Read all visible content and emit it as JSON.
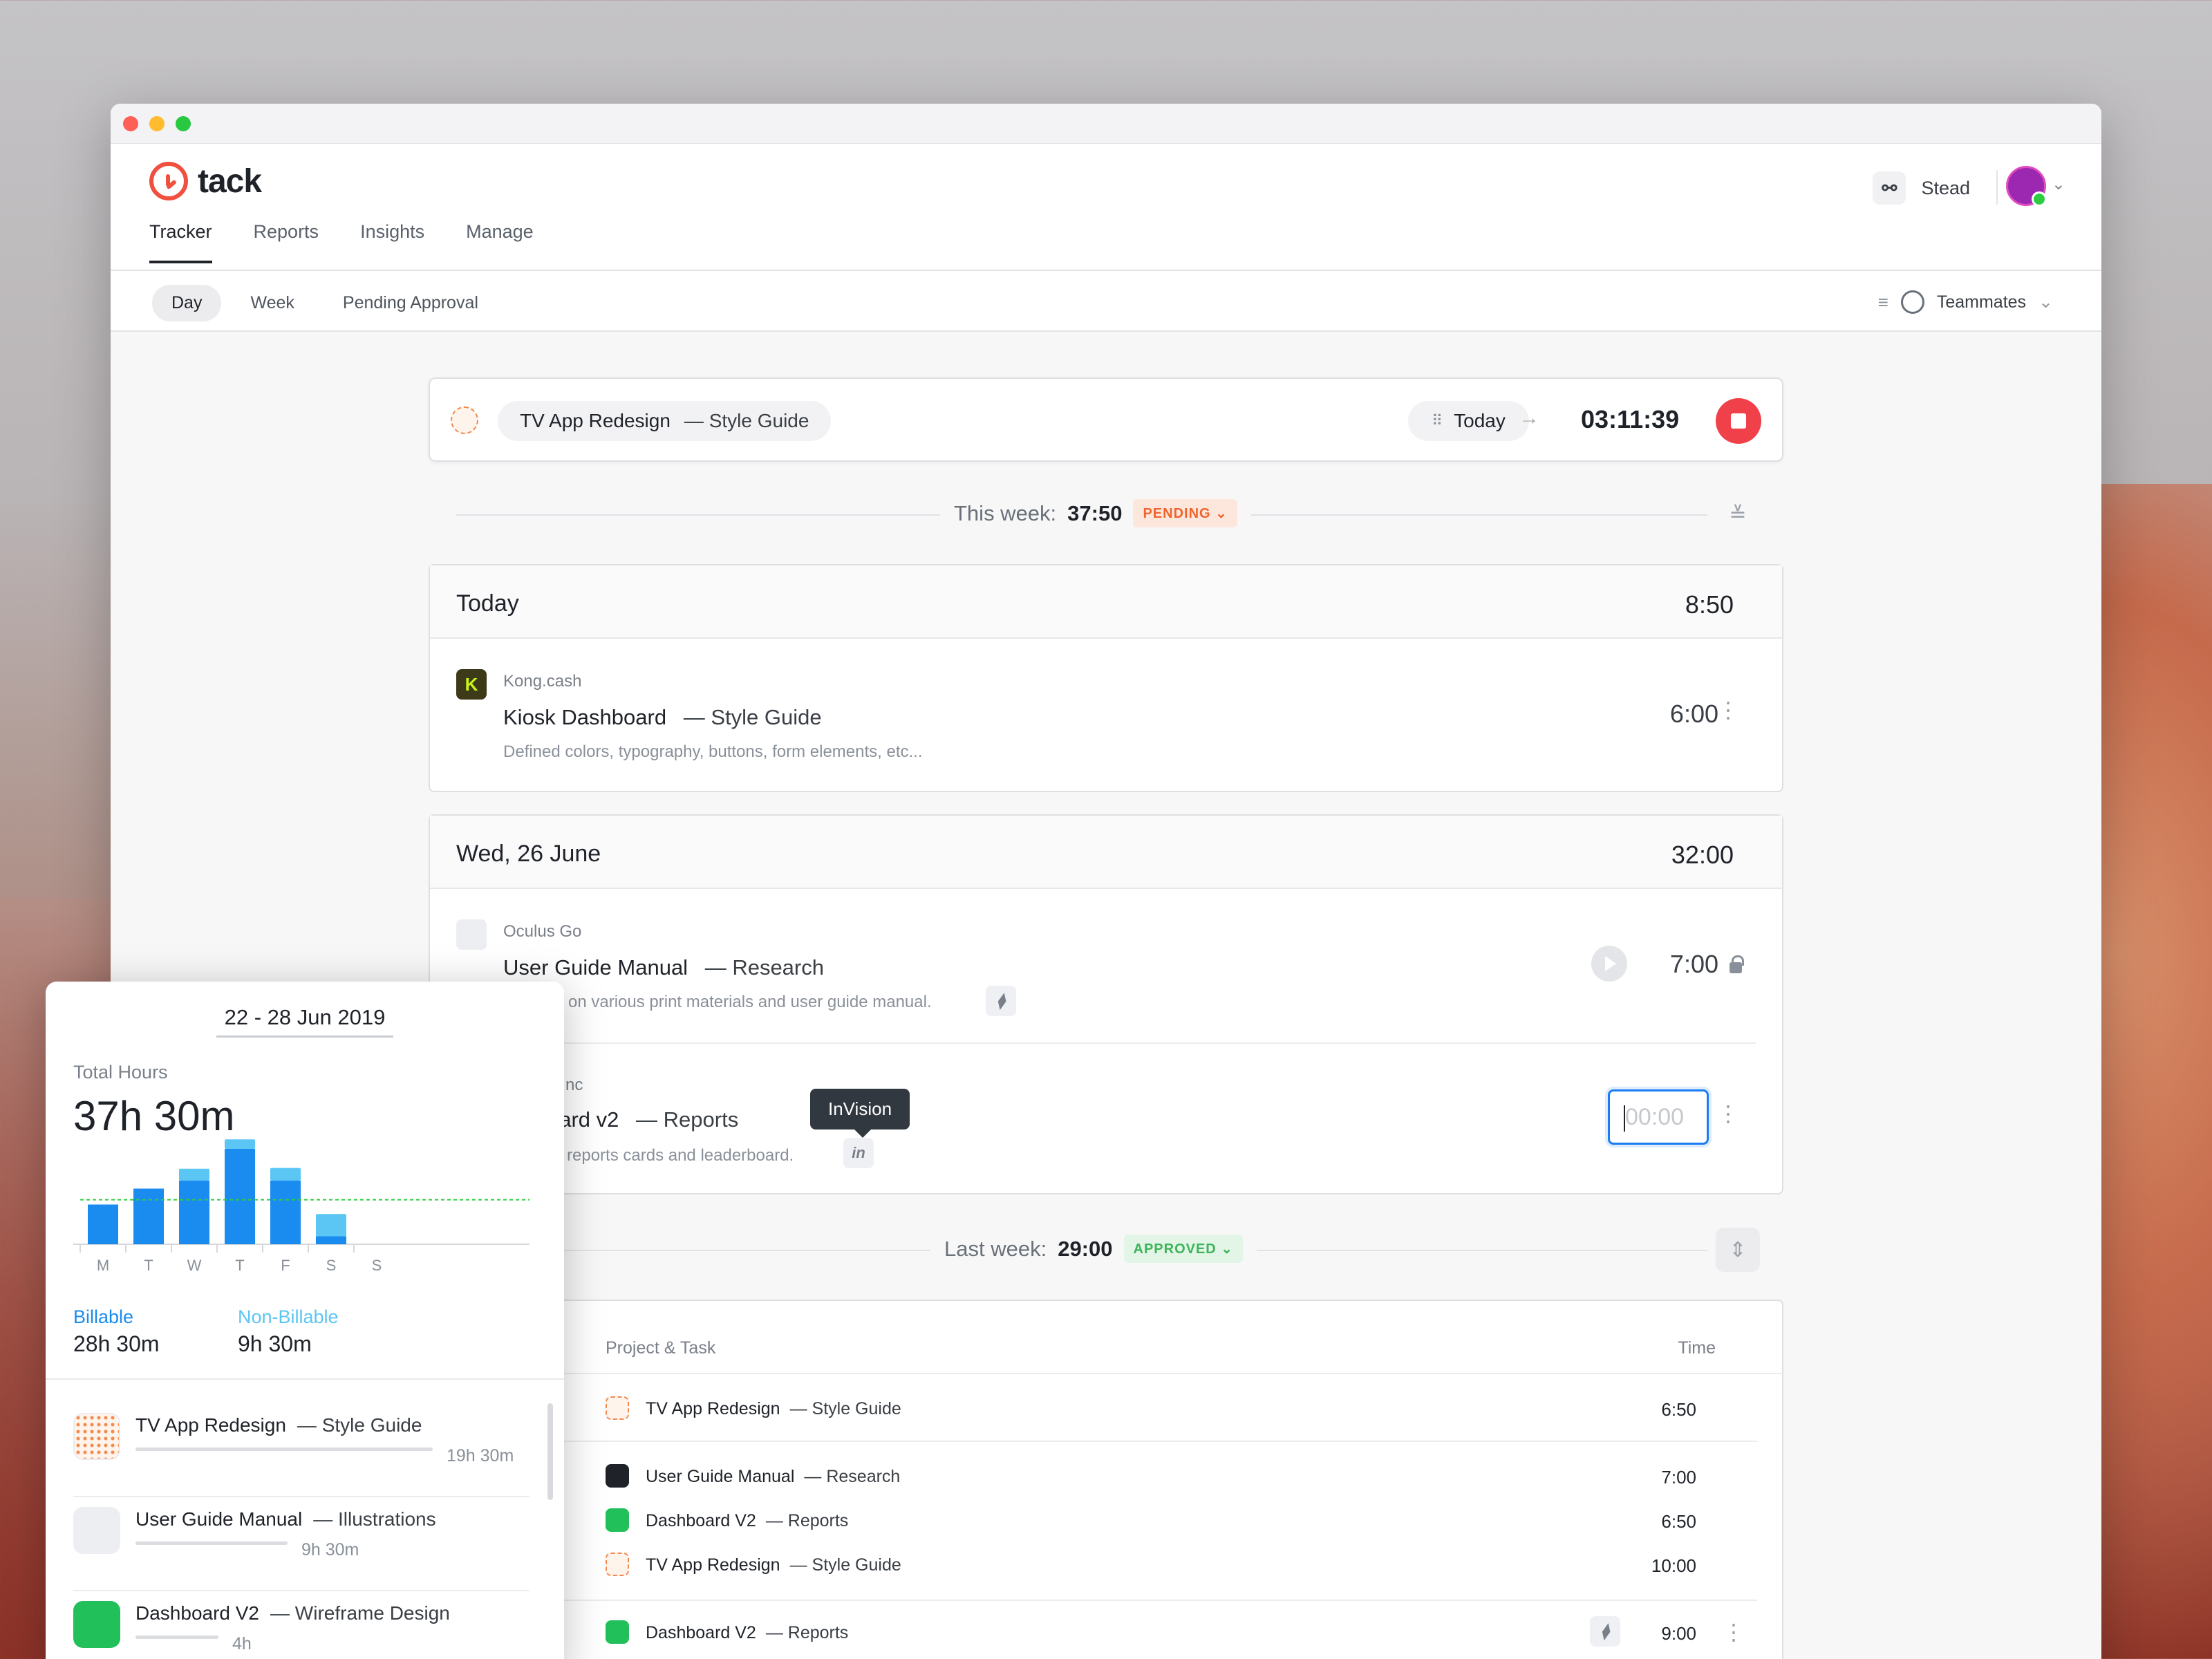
{
  "app": {
    "name": "tack"
  },
  "header": {
    "nav": [
      "Tracker",
      "Reports",
      "Insights",
      "Manage"
    ],
    "workspace": "Stead"
  },
  "subnav": {
    "tabs": [
      "Day",
      "Week",
      "Pending Approval"
    ],
    "filter_label": "Teammates"
  },
  "timer": {
    "project": "TV App Redesign",
    "task": "— Style Guide",
    "day": "Today",
    "elapsed": "03:11:39"
  },
  "this_week": {
    "label": "This week:",
    "total": "37:50",
    "status": "PENDING"
  },
  "today_card": {
    "date": "Today",
    "total": "8:50",
    "entries": [
      {
        "client": "Kong.cash",
        "project": "Kiosk Dashboard",
        "task": "— Style Guide",
        "desc": "Defined colors, typography, buttons, form elements, etc...",
        "time": "6:00",
        "icon_letter": "K"
      }
    ]
  },
  "wed_card": {
    "date": "Wed, 26 June",
    "total": "32:00",
    "entries": [
      {
        "client": "Oculus Go",
        "project": "User Guide Manual",
        "task": "— Research",
        "desc": "on various print materials and user guide manual.",
        "time": "7:00"
      },
      {
        "client": "nc",
        "project": "oard v2",
        "task": "— Reports",
        "desc": "d reports cards and leaderboard.",
        "time_placeholder": "00:00",
        "tooltip": "InVision"
      }
    ]
  },
  "last_week": {
    "label": "Last week:",
    "total": "29:00",
    "status": "APPROVED",
    "columns": {
      "project": "Project & Task",
      "time": "Time"
    },
    "rows": [
      {
        "project": "TV App Redesign",
        "task": "— Style Guide",
        "time": "6:50"
      },
      {
        "project": "User Guide Manual",
        "task": "— Research",
        "time": "7:00"
      },
      {
        "project": "Dashboard V2",
        "task": "— Reports",
        "time": "6:50"
      },
      {
        "project": "TV App Redesign",
        "task": "— Style Guide",
        "time": "10:00"
      },
      {
        "project": "Dashboard V2",
        "task": "— Reports",
        "time": "9:00"
      }
    ]
  },
  "popup": {
    "range": "22 - 28 Jun 2019",
    "total_label": "Total Hours",
    "total_value": "37h 30m",
    "billable_label": "Billable",
    "billable_value": "28h 30m",
    "nonbillable_label": "Non-Billable",
    "nonbillable_value": "9h 30m",
    "projects": [
      {
        "project": "TV App Redesign",
        "task": "— Style Guide",
        "hours": "19h 30m"
      },
      {
        "project": "User Guide Manual",
        "task": "— Illustrations",
        "hours": "9h 30m"
      },
      {
        "project": "Dashboard V2",
        "task": "— Wireframe Design",
        "hours": "4h"
      }
    ]
  },
  "chart_data": {
    "type": "bar",
    "categories": [
      "M",
      "T",
      "W",
      "T",
      "F",
      "S",
      "S"
    ],
    "series": [
      {
        "name": "Billable",
        "values": [
          5,
          7,
          8,
          12,
          8,
          1,
          0
        ]
      },
      {
        "name": "Non-Billable",
        "values": [
          0,
          0,
          1.5,
          1.2,
          1.6,
          2.8,
          0
        ]
      }
    ],
    "target_line": 5.6,
    "colors": {
      "billable": "#1a8cf0",
      "nonbillable": "#5bc6f4",
      "target": "#2ecc40"
    }
  }
}
